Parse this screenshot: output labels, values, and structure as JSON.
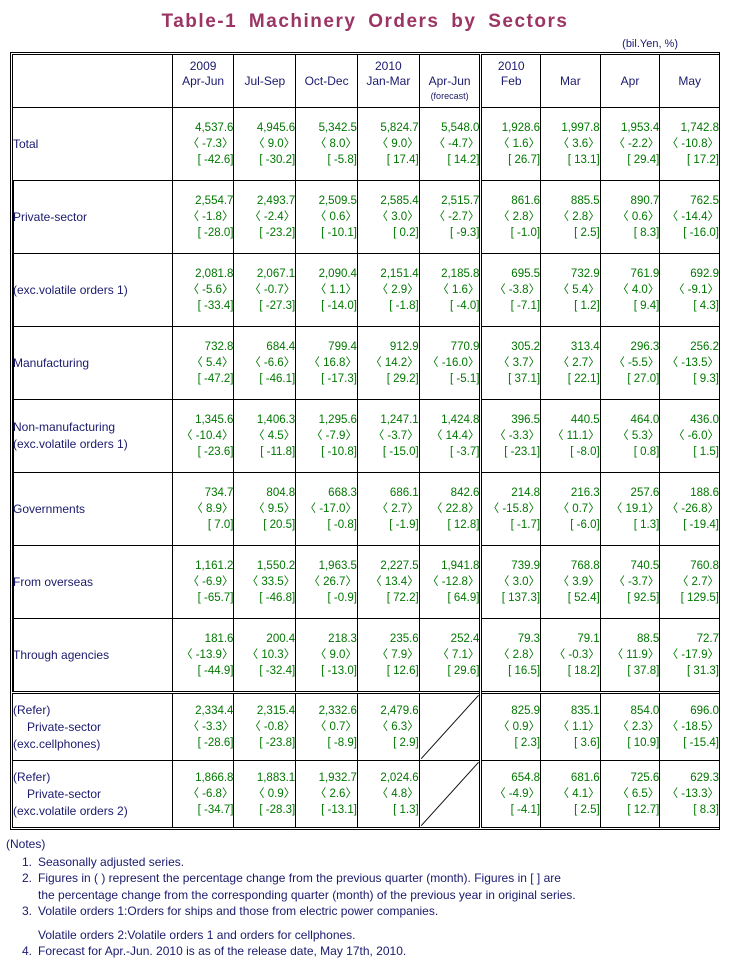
{
  "title": "Table-1  Machinery  Orders  by  Sectors",
  "unit": "(bil.Yen, %)",
  "colors": {
    "title": "#9b3564",
    "label_text": "#1a1a6e",
    "number_text": "#007700",
    "border": "#000000"
  },
  "header": {
    "corner": "",
    "columns": [
      {
        "year": "2009",
        "period": "Apr-Jun",
        "note": ""
      },
      {
        "year": "",
        "period": "Jul-Sep",
        "note": ""
      },
      {
        "year": "",
        "period": "Oct-Dec",
        "note": ""
      },
      {
        "year": "2010",
        "period": "Jan-Mar",
        "note": ""
      },
      {
        "year": "",
        "period": "Apr-Jun",
        "note": "(forecast)"
      },
      {
        "year": "2010",
        "period": "Feb",
        "note": ""
      },
      {
        "year": "",
        "period": "Mar",
        "note": ""
      },
      {
        "year": "",
        "period": "Apr",
        "note": ""
      },
      {
        "year": "",
        "period": "May",
        "note": ""
      }
    ]
  },
  "rows": [
    {
      "label_line1": "Total",
      "label_line2": "",
      "indent": 0,
      "cells": [
        {
          "value": "4,537.6",
          "qoq": "〈 -7.3〉",
          "yoy": "[ -42.6]"
        },
        {
          "value": "4,945.6",
          "qoq": "〈 9.0〉",
          "yoy": "[ -30.2]"
        },
        {
          "value": "5,342.5",
          "qoq": "〈 8.0〉",
          "yoy": "[ -5.8]"
        },
        {
          "value": "5,824.7",
          "qoq": "〈 9.0〉",
          "yoy": "[ 17.4]"
        },
        {
          "value": "5,548.0",
          "qoq": "〈 -4.7〉",
          "yoy": "[ 14.2]"
        },
        {
          "value": "1,928.6",
          "qoq": "〈 1.6〉",
          "yoy": "[ 26.7]"
        },
        {
          "value": "1,997.8",
          "qoq": "〈 3.6〉",
          "yoy": "[ 13.1]"
        },
        {
          "value": "1,953.4",
          "qoq": "〈 -2.2〉",
          "yoy": "[ 29.4]"
        },
        {
          "value": "1,742.8",
          "qoq": "〈 -10.8〉",
          "yoy": "[ 17.2]"
        }
      ]
    },
    {
      "label_line1": "Private-sector",
      "label_line2": "",
      "indent": 1,
      "cells": [
        {
          "value": "2,554.7",
          "qoq": "〈 -1.8〉",
          "yoy": "[ -28.0]"
        },
        {
          "value": "2,493.7",
          "qoq": "〈 -2.4〉",
          "yoy": "[ -23.2]"
        },
        {
          "value": "2,509.5",
          "qoq": "〈 0.6〉",
          "yoy": "[ -10.1]"
        },
        {
          "value": "2,585.4",
          "qoq": "〈 3.0〉",
          "yoy": "[ 0.2]"
        },
        {
          "value": "2,515.7",
          "qoq": "〈 -2.7〉",
          "yoy": "[ -9.3]"
        },
        {
          "value": "861.6",
          "qoq": "〈 2.8〉",
          "yoy": "[ -1.0]"
        },
        {
          "value": "885.5",
          "qoq": "〈 2.8〉",
          "yoy": "[ 2.5]"
        },
        {
          "value": "890.7",
          "qoq": "〈 0.6〉",
          "yoy": "[ 8.3]"
        },
        {
          "value": "762.5",
          "qoq": "〈 -14.4〉",
          "yoy": "[ -16.0]"
        }
      ]
    },
    {
      "label_line1": "(exc.volatile orders 1)",
      "label_line2": "",
      "indent": 1,
      "cells": [
        {
          "value": "2,081.8",
          "qoq": "〈 -5.6〉",
          "yoy": "[ -33.4]"
        },
        {
          "value": "2,067.1",
          "qoq": "〈 -0.7〉",
          "yoy": "[ -27.3]"
        },
        {
          "value": "2,090.4",
          "qoq": "〈 1.1〉",
          "yoy": "[ -14.0]"
        },
        {
          "value": "2,151.4",
          "qoq": "〈 2.9〉",
          "yoy": "[ -1.8]"
        },
        {
          "value": "2,185.8",
          "qoq": "〈 1.6〉",
          "yoy": "[ -4.0]"
        },
        {
          "value": "695.5",
          "qoq": "〈 -3.8〉",
          "yoy": "[ -7.1]"
        },
        {
          "value": "732.9",
          "qoq": "〈 5.4〉",
          "yoy": "[ 1.2]"
        },
        {
          "value": "761.9",
          "qoq": "〈 4.0〉",
          "yoy": "[ 9.4]"
        },
        {
          "value": "692.9",
          "qoq": "〈 -9.1〉",
          "yoy": "[ 4.3]"
        }
      ]
    },
    {
      "label_line1": "Manufacturing",
      "label_line2": "",
      "indent": 2,
      "cells": [
        {
          "value": "732.8",
          "qoq": "〈 5.4〉",
          "yoy": "[ -47.2]"
        },
        {
          "value": "684.4",
          "qoq": "〈 -6.6〉",
          "yoy": "[ -46.1]"
        },
        {
          "value": "799.4",
          "qoq": "〈 16.8〉",
          "yoy": "[ -17.3]"
        },
        {
          "value": "912.9",
          "qoq": "〈 14.2〉",
          "yoy": "[ 29.2]"
        },
        {
          "value": "770.9",
          "qoq": "〈 -16.0〉",
          "yoy": "[ -5.1]"
        },
        {
          "value": "305.2",
          "qoq": "〈 3.7〉",
          "yoy": "[ 37.1]"
        },
        {
          "value": "313.4",
          "qoq": "〈 2.7〉",
          "yoy": "[ 22.1]"
        },
        {
          "value": "296.3",
          "qoq": "〈 -5.5〉",
          "yoy": "[ 27.0]"
        },
        {
          "value": "256.2",
          "qoq": "〈 -13.5〉",
          "yoy": "[ 9.3]"
        }
      ]
    },
    {
      "label_line1": "Non-manufacturing",
      "label_line2": "(exc.volatile orders 1)",
      "indent": 2,
      "cells": [
        {
          "value": "1,345.6",
          "qoq": "〈 -10.4〉",
          "yoy": "[ -23.6]"
        },
        {
          "value": "1,406.3",
          "qoq": "〈 4.5〉",
          "yoy": "[ -11.8]"
        },
        {
          "value": "1,295.6",
          "qoq": "〈 -7.9〉",
          "yoy": "[ -10.8]"
        },
        {
          "value": "1,247.1",
          "qoq": "〈 -3.7〉",
          "yoy": "[ -15.0]"
        },
        {
          "value": "1,424.8",
          "qoq": "〈 14.4〉",
          "yoy": "[ -3.7]"
        },
        {
          "value": "396.5",
          "qoq": "〈 -3.3〉",
          "yoy": "[ -23.1]"
        },
        {
          "value": "440.5",
          "qoq": "〈 11.1〉",
          "yoy": "[ -8.0]"
        },
        {
          "value": "464.0",
          "qoq": "〈 5.3〉",
          "yoy": "[ 0.8]"
        },
        {
          "value": "436.0",
          "qoq": "〈 -6.0〉",
          "yoy": "[ 1.5]"
        }
      ]
    },
    {
      "label_line1": "Governments",
      "label_line2": "",
      "indent": 1,
      "cells": [
        {
          "value": "734.7",
          "qoq": "〈 8.9〉",
          "yoy": "[ 7.0]"
        },
        {
          "value": "804.8",
          "qoq": "〈 9.5〉",
          "yoy": "[ 20.5]"
        },
        {
          "value": "668.3",
          "qoq": "〈 -17.0〉",
          "yoy": "[ -0.8]"
        },
        {
          "value": "686.1",
          "qoq": "〈 2.7〉",
          "yoy": "[ -1.9]"
        },
        {
          "value": "842.6",
          "qoq": "〈 22.8〉",
          "yoy": "[ 12.8]"
        },
        {
          "value": "214.8",
          "qoq": "〈 -15.8〉",
          "yoy": "[ -1.7]"
        },
        {
          "value": "216.3",
          "qoq": "〈 0.7〉",
          "yoy": "[ -6.0]"
        },
        {
          "value": "257.6",
          "qoq": "〈 19.1〉",
          "yoy": "[ 1.3]"
        },
        {
          "value": "188.6",
          "qoq": "〈 -26.8〉",
          "yoy": "[ -19.4]"
        }
      ]
    },
    {
      "label_line1": "From overseas",
      "label_line2": "",
      "indent": 1,
      "cells": [
        {
          "value": "1,161.2",
          "qoq": "〈 -6.9〉",
          "yoy": "[ -65.7]"
        },
        {
          "value": "1,550.2",
          "qoq": "〈 33.5〉",
          "yoy": "[ -46.8]"
        },
        {
          "value": "1,963.5",
          "qoq": "〈 26.7〉",
          "yoy": "[ -0.9]"
        },
        {
          "value": "2,227.5",
          "qoq": "〈 13.4〉",
          "yoy": "[ 72.2]"
        },
        {
          "value": "1,941.8",
          "qoq": "〈 -12.8〉",
          "yoy": "[ 64.9]"
        },
        {
          "value": "739.9",
          "qoq": "〈 3.0〉",
          "yoy": "[ 137.3]"
        },
        {
          "value": "768.8",
          "qoq": "〈 3.9〉",
          "yoy": "[ 52.4]"
        },
        {
          "value": "740.5",
          "qoq": "〈 -3.7〉",
          "yoy": "[ 92.5]"
        },
        {
          "value": "760.8",
          "qoq": "〈 2.7〉",
          "yoy": "[ 129.5]"
        }
      ]
    },
    {
      "label_line1": "Through agencies",
      "label_line2": "",
      "indent": 1,
      "cells": [
        {
          "value": "181.6",
          "qoq": "〈 -13.9〉",
          "yoy": "[ -44.9]"
        },
        {
          "value": "200.4",
          "qoq": "〈 10.3〉",
          "yoy": "[ -32.4]"
        },
        {
          "value": "218.3",
          "qoq": "〈 9.0〉",
          "yoy": "[ -13.0]"
        },
        {
          "value": "235.6",
          "qoq": "〈 7.9〉",
          "yoy": "[ 12.6]"
        },
        {
          "value": "252.4",
          "qoq": "〈 7.1〉",
          "yoy": "[ 29.6]"
        },
        {
          "value": "79.3",
          "qoq": "〈 2.8〉",
          "yoy": "[ 16.5]"
        },
        {
          "value": "79.1",
          "qoq": "〈 -0.3〉",
          "yoy": "[ 18.2]"
        },
        {
          "value": "88.5",
          "qoq": "〈 11.9〉",
          "yoy": "[ 37.8]"
        },
        {
          "value": "72.7",
          "qoq": "〈 -17.9〉",
          "yoy": "[ 31.3]"
        }
      ]
    },
    {
      "label_line1": "(Refer)",
      "label_line2": "Private-sector",
      "label_line3": "(exc.cellphones)",
      "indent": 0,
      "refer": true,
      "cells": [
        {
          "value": "2,334.4",
          "qoq": "〈 -3.3〉",
          "yoy": "[ -28.6]"
        },
        {
          "value": "2,315.4",
          "qoq": "〈 -0.8〉",
          "yoy": "[ -23.8]"
        },
        {
          "value": "2,332.6",
          "qoq": "〈 0.7〉",
          "yoy": "[ -8.9]"
        },
        {
          "value": "2,479.6",
          "qoq": "〈 6.3〉",
          "yoy": "[ 2.9]"
        },
        {
          "value": "",
          "qoq": "",
          "yoy": "",
          "slash": true
        },
        {
          "value": "825.9",
          "qoq": "〈 0.9〉",
          "yoy": "[ 2.3]"
        },
        {
          "value": "835.1",
          "qoq": "〈 1.1〉",
          "yoy": "[ 3.6]"
        },
        {
          "value": "854.0",
          "qoq": "〈 2.3〉",
          "yoy": "[ 10.9]"
        },
        {
          "value": "696.0",
          "qoq": "〈 -18.5〉",
          "yoy": "[ -15.4]"
        }
      ]
    },
    {
      "label_line1": "(Refer)",
      "label_line2": "Private-sector",
      "label_line3": "(exc.volatile orders 2)",
      "indent": 0,
      "refer": true,
      "cells": [
        {
          "value": "1,866.8",
          "qoq": "〈 -6.8〉",
          "yoy": "[ -34.7]"
        },
        {
          "value": "1,883.1",
          "qoq": "〈 0.9〉",
          "yoy": "[ -28.3]"
        },
        {
          "value": "1,932.7",
          "qoq": "〈 2.6〉",
          "yoy": "[ -13.1]"
        },
        {
          "value": "2,024.6",
          "qoq": "〈 4.8〉",
          "yoy": "[ 1.3]"
        },
        {
          "value": "",
          "qoq": "",
          "yoy": "",
          "slash": true
        },
        {
          "value": "654.8",
          "qoq": "〈 -4.9〉",
          "yoy": "[ -4.1]"
        },
        {
          "value": "681.6",
          "qoq": "〈 4.1〉",
          "yoy": "[ 2.5]"
        },
        {
          "value": "725.6",
          "qoq": "〈 6.5〉",
          "yoy": "[ 12.7]"
        },
        {
          "value": "629.3",
          "qoq": "〈 -13.3〉",
          "yoy": "[ 8.3]"
        }
      ]
    }
  ],
  "notes": {
    "heading": "(Notes)",
    "items": [
      {
        "num": "1.",
        "text": "Seasonally adjusted series."
      },
      {
        "num": "2.",
        "text": "Figures in ( ) represent the percentage change from the previous quarter (month). Figures in [ ] are",
        "cont": "the percentage change from the corresponding quarter (month) of the previous year in original series."
      },
      {
        "num": "3.",
        "text": "Volatile orders 1:Orders for ships and those from electric power companies.",
        "sub": "Volatile orders 2:Volatile orders 1 and orders for cellphones."
      },
      {
        "num": "4.",
        "text": "Forecast for Apr.-Jun. 2010 is as of the release date, May 17th, 2010."
      }
    ]
  }
}
